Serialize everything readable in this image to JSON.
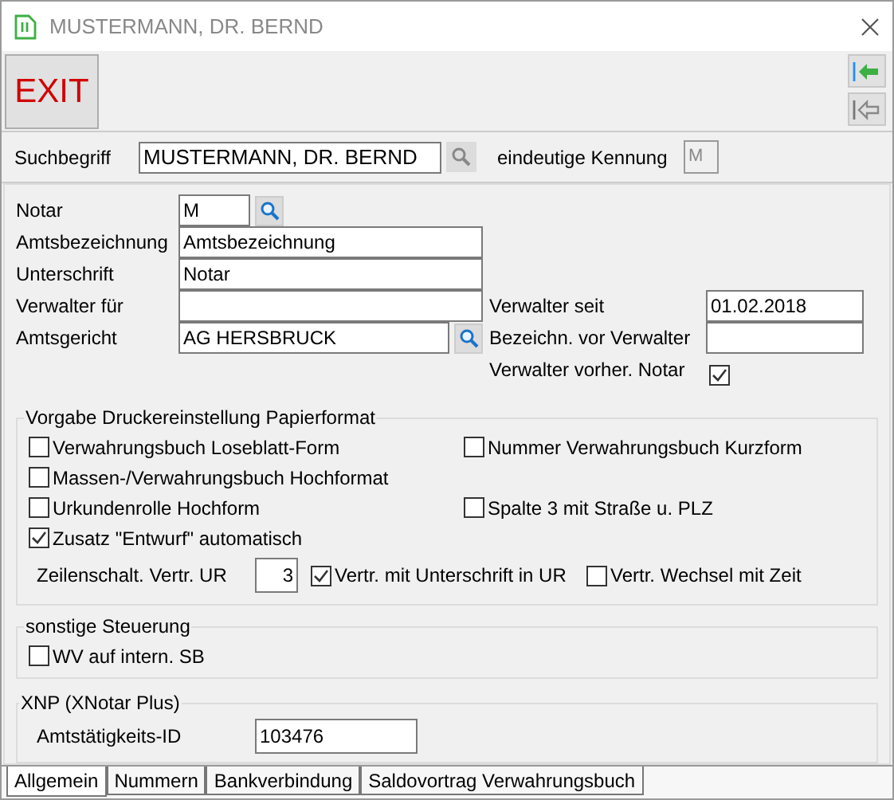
{
  "window": {
    "title": "MUSTERMANN, DR. BERND"
  },
  "toolbar": {
    "exit_button": "EXIT"
  },
  "search": {
    "label": "Suchbegriff",
    "value": "MUSTERMANN, DR. BERND",
    "id_label": "eindeutige Kennung",
    "id_value": "M"
  },
  "form_rows": [
    {
      "left": {
        "label": "Notar",
        "value": "M",
        "kind": "short_lookup"
      }
    },
    {
      "left": {
        "label": "Amtsbezeichnung",
        "value": "Amtsbezeichnung",
        "kind": "text"
      }
    },
    {
      "left": {
        "label": "Unterschrift",
        "value": "Notar",
        "kind": "text"
      }
    },
    {
      "left": {
        "label": "Verwalter für",
        "kind": "text"
      },
      "right": {
        "label": "Verwalter seit",
        "value": "01.02.2018",
        "kind": "text"
      }
    },
    {
      "left": {
        "label": "Amtsgericht",
        "value": "AG HERSBRUCK",
        "kind": "lookup"
      },
      "right": {
        "label": "Bezeichn. vor Verwalter",
        "kind": "text"
      }
    },
    {
      "right": {
        "label": "Verwalter vorher. Notar",
        "checked": true,
        "kind": "checkbox"
      }
    }
  ],
  "print_settings": {
    "title": "Vorgabe Druckereinstellung Papierformat",
    "rows": [
      [
        {
          "label": "Verwahrungsbuch Loseblatt-Form",
          "checked": false
        },
        {
          "label": "Nummer Verwahrungsbuch Kurzform",
          "checked": false
        }
      ],
      [
        {
          "label": "Massen-/Verwahrungsbuch Hochformat",
          "checked": false
        }
      ],
      [
        {
          "label": "Urkundenrolle Hochform",
          "checked": false
        },
        {
          "label": "Spalte 3 mit Straße u. PLZ",
          "checked": false
        }
      ],
      [
        {
          "label": "Zusatz \"Entwurf\" automatisch",
          "checked": true
        }
      ]
    ],
    "line_spacing": {
      "label": "Zeilenschalt. Vertr. UR",
      "value": "3"
    },
    "extra_options": [
      {
        "label": "Vertr. mit Unterschrift in UR",
        "checked": true
      },
      {
        "label": "Vertr. Wechsel mit Zeit",
        "checked": false
      }
    ]
  },
  "other_controls": {
    "title": "sonstige Steuerung",
    "options": [
      {
        "label": "WV auf intern. SB",
        "checked": false
      }
    ]
  },
  "xnp": {
    "title": "XNP (XNotar Plus)",
    "label": "Amtstätigkeits-ID",
    "value": "103476"
  },
  "tabs": [
    {
      "label": "Allgemein",
      "selected": true
    },
    {
      "label": "Nummern",
      "selected": false
    },
    {
      "label": "Bankverbindung",
      "selected": false
    },
    {
      "label": "Saldovortrag Verwahrungsbuch",
      "selected": false
    }
  ]
}
